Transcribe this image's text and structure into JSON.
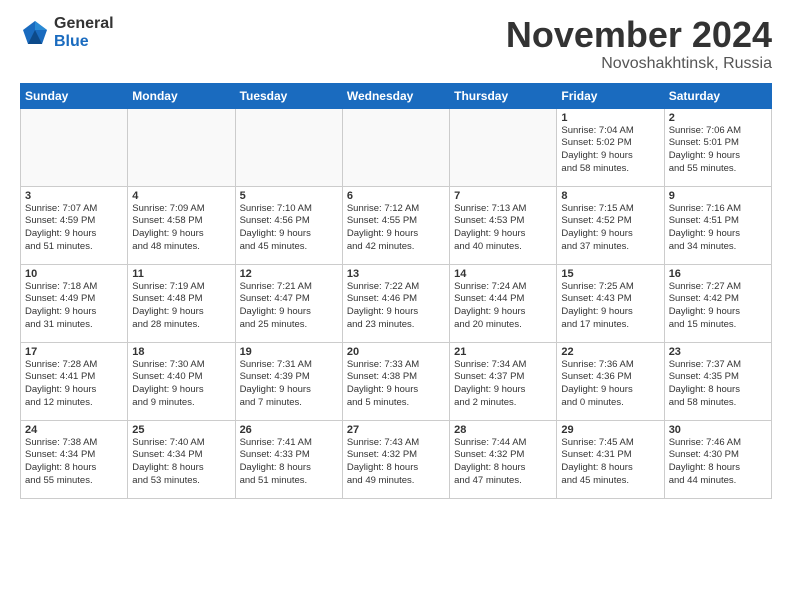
{
  "logo": {
    "general": "General",
    "blue": "Blue"
  },
  "title": "November 2024",
  "location": "Novoshakhtinsk, Russia",
  "weekdays": [
    "Sunday",
    "Monday",
    "Tuesday",
    "Wednesday",
    "Thursday",
    "Friday",
    "Saturday"
  ],
  "weeks": [
    [
      {
        "day": "",
        "info": ""
      },
      {
        "day": "",
        "info": ""
      },
      {
        "day": "",
        "info": ""
      },
      {
        "day": "",
        "info": ""
      },
      {
        "day": "",
        "info": ""
      },
      {
        "day": "1",
        "info": "Sunrise: 7:04 AM\nSunset: 5:02 PM\nDaylight: 9 hours\nand 58 minutes."
      },
      {
        "day": "2",
        "info": "Sunrise: 7:06 AM\nSunset: 5:01 PM\nDaylight: 9 hours\nand 55 minutes."
      }
    ],
    [
      {
        "day": "3",
        "info": "Sunrise: 7:07 AM\nSunset: 4:59 PM\nDaylight: 9 hours\nand 51 minutes."
      },
      {
        "day": "4",
        "info": "Sunrise: 7:09 AM\nSunset: 4:58 PM\nDaylight: 9 hours\nand 48 minutes."
      },
      {
        "day": "5",
        "info": "Sunrise: 7:10 AM\nSunset: 4:56 PM\nDaylight: 9 hours\nand 45 minutes."
      },
      {
        "day": "6",
        "info": "Sunrise: 7:12 AM\nSunset: 4:55 PM\nDaylight: 9 hours\nand 42 minutes."
      },
      {
        "day": "7",
        "info": "Sunrise: 7:13 AM\nSunset: 4:53 PM\nDaylight: 9 hours\nand 40 minutes."
      },
      {
        "day": "8",
        "info": "Sunrise: 7:15 AM\nSunset: 4:52 PM\nDaylight: 9 hours\nand 37 minutes."
      },
      {
        "day": "9",
        "info": "Sunrise: 7:16 AM\nSunset: 4:51 PM\nDaylight: 9 hours\nand 34 minutes."
      }
    ],
    [
      {
        "day": "10",
        "info": "Sunrise: 7:18 AM\nSunset: 4:49 PM\nDaylight: 9 hours\nand 31 minutes."
      },
      {
        "day": "11",
        "info": "Sunrise: 7:19 AM\nSunset: 4:48 PM\nDaylight: 9 hours\nand 28 minutes."
      },
      {
        "day": "12",
        "info": "Sunrise: 7:21 AM\nSunset: 4:47 PM\nDaylight: 9 hours\nand 25 minutes."
      },
      {
        "day": "13",
        "info": "Sunrise: 7:22 AM\nSunset: 4:46 PM\nDaylight: 9 hours\nand 23 minutes."
      },
      {
        "day": "14",
        "info": "Sunrise: 7:24 AM\nSunset: 4:44 PM\nDaylight: 9 hours\nand 20 minutes."
      },
      {
        "day": "15",
        "info": "Sunrise: 7:25 AM\nSunset: 4:43 PM\nDaylight: 9 hours\nand 17 minutes."
      },
      {
        "day": "16",
        "info": "Sunrise: 7:27 AM\nSunset: 4:42 PM\nDaylight: 9 hours\nand 15 minutes."
      }
    ],
    [
      {
        "day": "17",
        "info": "Sunrise: 7:28 AM\nSunset: 4:41 PM\nDaylight: 9 hours\nand 12 minutes."
      },
      {
        "day": "18",
        "info": "Sunrise: 7:30 AM\nSunset: 4:40 PM\nDaylight: 9 hours\nand 9 minutes."
      },
      {
        "day": "19",
        "info": "Sunrise: 7:31 AM\nSunset: 4:39 PM\nDaylight: 9 hours\nand 7 minutes."
      },
      {
        "day": "20",
        "info": "Sunrise: 7:33 AM\nSunset: 4:38 PM\nDaylight: 9 hours\nand 5 minutes."
      },
      {
        "day": "21",
        "info": "Sunrise: 7:34 AM\nSunset: 4:37 PM\nDaylight: 9 hours\nand 2 minutes."
      },
      {
        "day": "22",
        "info": "Sunrise: 7:36 AM\nSunset: 4:36 PM\nDaylight: 9 hours\nand 0 minutes."
      },
      {
        "day": "23",
        "info": "Sunrise: 7:37 AM\nSunset: 4:35 PM\nDaylight: 8 hours\nand 58 minutes."
      }
    ],
    [
      {
        "day": "24",
        "info": "Sunrise: 7:38 AM\nSunset: 4:34 PM\nDaylight: 8 hours\nand 55 minutes."
      },
      {
        "day": "25",
        "info": "Sunrise: 7:40 AM\nSunset: 4:34 PM\nDaylight: 8 hours\nand 53 minutes."
      },
      {
        "day": "26",
        "info": "Sunrise: 7:41 AM\nSunset: 4:33 PM\nDaylight: 8 hours\nand 51 minutes."
      },
      {
        "day": "27",
        "info": "Sunrise: 7:43 AM\nSunset: 4:32 PM\nDaylight: 8 hours\nand 49 minutes."
      },
      {
        "day": "28",
        "info": "Sunrise: 7:44 AM\nSunset: 4:32 PM\nDaylight: 8 hours\nand 47 minutes."
      },
      {
        "day": "29",
        "info": "Sunrise: 7:45 AM\nSunset: 4:31 PM\nDaylight: 8 hours\nand 45 minutes."
      },
      {
        "day": "30",
        "info": "Sunrise: 7:46 AM\nSunset: 4:30 PM\nDaylight: 8 hours\nand 44 minutes."
      }
    ]
  ]
}
